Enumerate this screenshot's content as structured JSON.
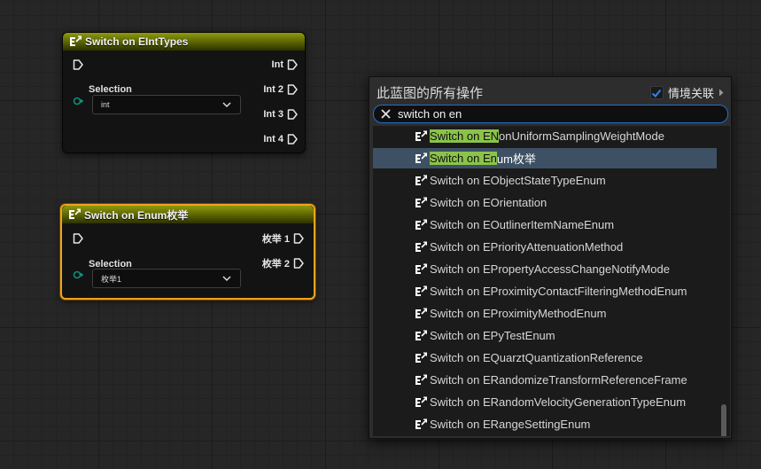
{
  "nodes": {
    "int_switch": {
      "title": "Switch on EIntTypes",
      "outputs": [
        "Int",
        "Int 2",
        "Int 3",
        "Int 4"
      ],
      "selection_label": "Selection",
      "selection_value": "int"
    },
    "enum_switch": {
      "title": "Switch on Enum枚举",
      "outputs": [
        "枚举 1",
        "枚举 2"
      ],
      "selection_label": "Selection",
      "selection_value": "枚举1"
    }
  },
  "menu": {
    "title": "此蓝图的所有操作",
    "context_label": "情境关联",
    "context_checked": true,
    "search_value": "switch on en",
    "items": [
      {
        "match": "Switch on EN",
        "rest": "onUniformSamplingWeightMode"
      },
      {
        "match": "Switch on En",
        "rest": "um枚举"
      },
      {
        "match": "",
        "rest": "Switch on EObjectStateTypeEnum"
      },
      {
        "match": "",
        "rest": "Switch on EOrientation"
      },
      {
        "match": "",
        "rest": "Switch on EOutlinerItemNameEnum"
      },
      {
        "match": "",
        "rest": "Switch on EPriorityAttenuationMethod"
      },
      {
        "match": "",
        "rest": "Switch on EPropertyAccessChangeNotifyMode"
      },
      {
        "match": "",
        "rest": "Switch on EProximityContactFilteringMethodEnum"
      },
      {
        "match": "",
        "rest": "Switch on EProximityMethodEnum"
      },
      {
        "match": "",
        "rest": "Switch on EPyTestEnum"
      },
      {
        "match": "",
        "rest": "Switch on EQuarztQuantizationReference"
      },
      {
        "match": "",
        "rest": "Switch on ERandomizeTransformReferenceFrame"
      },
      {
        "match": "",
        "rest": "Switch on ERandomVelocityGenerationTypeEnum"
      },
      {
        "match": "",
        "rest": "Switch on ERangeSettingEnum"
      }
    ]
  },
  "colors": {
    "node_header": "#8f9a10",
    "selection_outline": "#f0a31b",
    "search_border": "#1f6fd1",
    "match_highlight": "#8bc34a",
    "active_row": "#3e5063",
    "checkbox_check": "#2f86e8"
  },
  "icons": {
    "node_icon": "switch-node-icon",
    "exec_pin": "exec-pin-icon",
    "data_pin": "byte-pin-icon",
    "clear": "close-icon",
    "expand": "chevron-right-icon",
    "dropdown": "chevron-down-icon"
  }
}
